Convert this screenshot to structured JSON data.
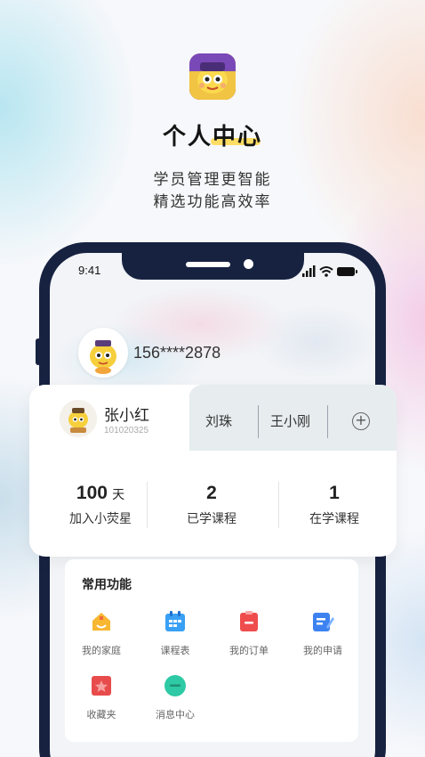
{
  "header": {
    "title": "个人中心",
    "subtitle_line1": "学员管理更智能",
    "subtitle_line2": "精选功能高效率"
  },
  "status_bar": {
    "time": "9:41"
  },
  "profile": {
    "phone": "156****2878"
  },
  "students": {
    "active": {
      "name": "张小红",
      "id": "101020325"
    },
    "others": [
      "刘珠",
      "王小刚"
    ],
    "add_icon": "plus-circle-icon"
  },
  "stats": [
    {
      "value": "100",
      "unit": "天",
      "label": "加入小荧星"
    },
    {
      "value": "2",
      "unit": "",
      "label": "已学课程"
    },
    {
      "value": "1",
      "unit": "",
      "label": "在学课程"
    }
  ],
  "features": {
    "title": "常用功能",
    "items": [
      {
        "label": "我的家庭",
        "icon": "home-icon",
        "color": "#f7b731"
      },
      {
        "label": "课程表",
        "icon": "calendar-icon",
        "color": "#3aa0f5"
      },
      {
        "label": "我的订单",
        "icon": "order-icon",
        "color": "#ef4d4d"
      },
      {
        "label": "我的申请",
        "icon": "application-icon",
        "color": "#3d82f0"
      },
      {
        "label": "收藏夹",
        "icon": "favorites-icon",
        "color": "#e84b4b"
      },
      {
        "label": "消息中心",
        "icon": "message-icon",
        "color": "#2ec9a5"
      }
    ]
  }
}
